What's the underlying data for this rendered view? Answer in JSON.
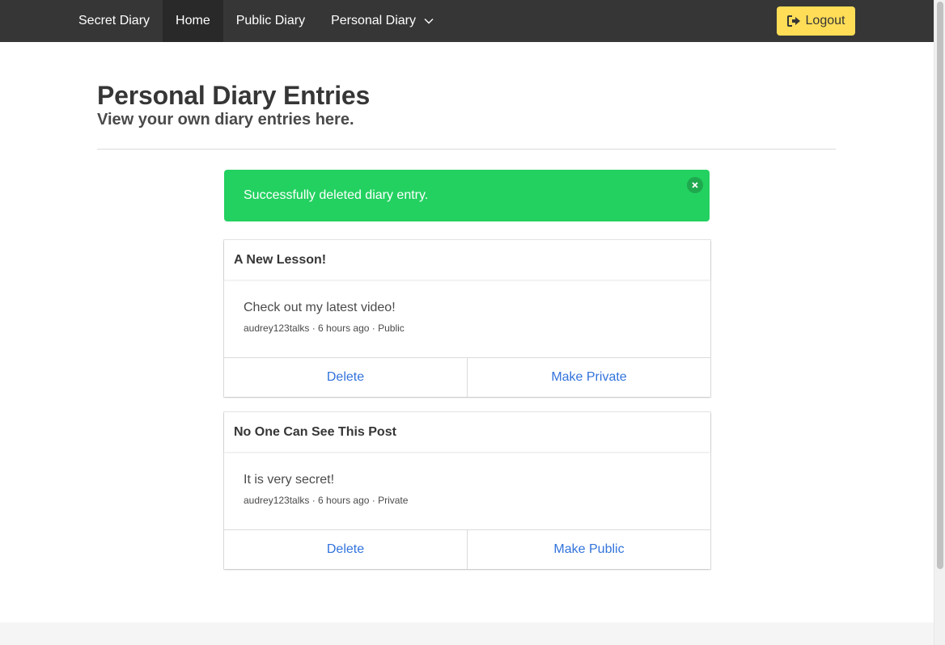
{
  "navbar": {
    "brand": "Secret Diary",
    "items": [
      {
        "label": "Home",
        "active": true
      },
      {
        "label": "Public Diary",
        "active": false
      },
      {
        "label": "Personal Diary",
        "active": false
      }
    ],
    "logout_label": "Logout",
    "logout_color": "#ffdd57",
    "background": "#363636"
  },
  "header": {
    "title": "Personal Diary Entries",
    "subtitle": "View your own diary entries here."
  },
  "notification": {
    "message": "Successfully deleted diary entry.",
    "color": "#23d160"
  },
  "entries": [
    {
      "title": "A New Lesson!",
      "body": "Check out my latest video!",
      "meta": "audrey123talks · 6 hours ago · Public",
      "actions": [
        "Delete",
        "Make Private"
      ]
    },
    {
      "title": "No One Can See This Post",
      "body": "It is very secret!",
      "meta": "audrey123talks · 6 hours ago · Private",
      "actions": [
        "Delete",
        "Make Public"
      ]
    }
  ],
  "icons": {
    "chevron": "chevron-down-icon",
    "logout": "sign-out-icon",
    "close": "close-icon"
  },
  "colors": {
    "link": "#3273dc"
  }
}
